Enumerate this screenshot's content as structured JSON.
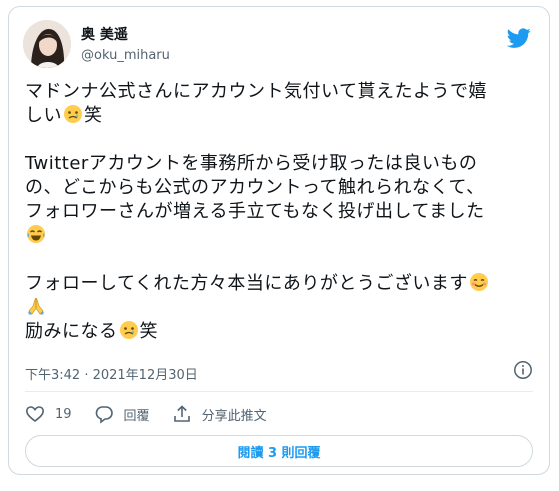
{
  "user": {
    "display_name": "奥 美遥",
    "handle": "@oku_miharu"
  },
  "tweet": {
    "line1": "マドンナ公式さんにアカウント気付いて貰えたようで嬉",
    "line2_pre": "しい",
    "line2_post": "笑",
    "line3": "Twitterアカウントを事務所から受け取ったは良いもの",
    "line4": "の、どこからも公式のアカウントって触れられなくて、",
    "line5": "フォロワーさんが増える手立てもなく投げ出してました",
    "line7": "フォローしてくれた方々本当にありがとうございます",
    "line9_pre": "励みになる",
    "line9_post": "笑"
  },
  "timestamp": "下午3:42 · 2021年12月30日",
  "actions": {
    "like_count": "19",
    "reply_label": "回覆",
    "share_label": "分享此推文"
  },
  "read_replies_label": "閱讀 3 則回覆",
  "colors": {
    "twitter_blue": "#1d9bf0",
    "muted": "#536471",
    "border": "#cfd9de"
  },
  "icons": [
    "avatar",
    "twitter-bird-icon",
    "holding-back-tears-emoji",
    "joy-emoji",
    "smiling-emoji",
    "folded-hands-emoji",
    "info-icon",
    "heart-icon",
    "reply-icon",
    "share-icon"
  ]
}
